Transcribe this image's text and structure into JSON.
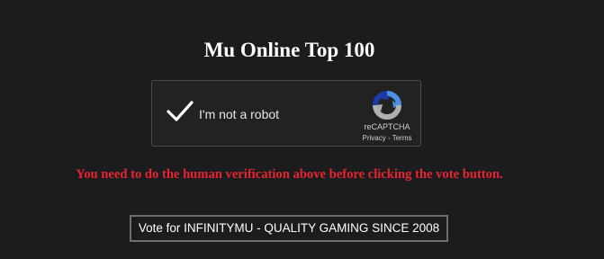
{
  "page": {
    "title": "Mu Online Top 100"
  },
  "recaptcha": {
    "label": "I'm not a robot",
    "checked": true,
    "brand": "reCAPTCHA",
    "privacy_label": "Privacy",
    "separator": " - ",
    "terms_label": "Terms"
  },
  "warning": {
    "text": "You need to do the human verification above before clicking the vote button."
  },
  "vote": {
    "button_label": "Vote for INFINITYMU - QUALITY GAMING SINCE 2008"
  },
  "colors": {
    "background": "#1b1c1d",
    "warning": "#e8242f",
    "checkmark": "#ffffff",
    "recaptcha_blue": "#4a90e2",
    "recaptcha_dark_blue": "#1c3aa9",
    "recaptcha_gray": "#b0b0b0"
  },
  "icons": {
    "checkmark": "checkmark-icon",
    "recaptcha_logo": "recaptcha-logo-icon"
  }
}
